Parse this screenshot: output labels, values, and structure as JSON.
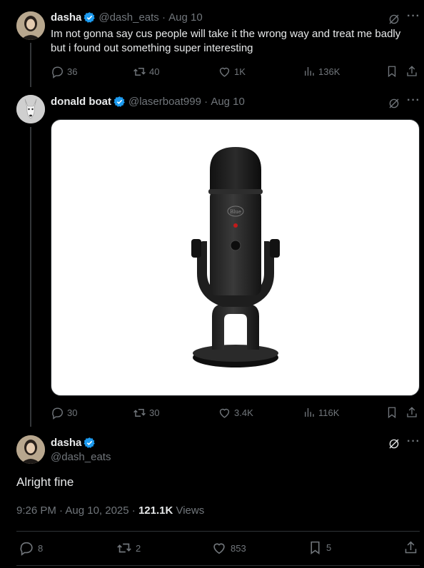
{
  "tweet1": {
    "name": "dasha",
    "handle": "@dash_eats",
    "date": "Aug 10",
    "text": "Im not gonna say cus people will take it the wrong way and treat me badly but i found out something super interesting",
    "replies": "36",
    "reposts": "40",
    "likes": "1K",
    "views": "136K"
  },
  "tweet2": {
    "name": "donald boat",
    "handle": "@laserboat999",
    "date": "Aug 10",
    "media_alt": "Blue Yeti microphone",
    "mic_brand": "Blue",
    "replies": "30",
    "reposts": "30",
    "likes": "3.4K",
    "views": "116K"
  },
  "tweet3": {
    "name": "dasha",
    "handle": "@dash_eats",
    "text": "Alright fine",
    "timestamp": "9:26 PM · Aug 10, 2025 · ",
    "views_count": "121.1K",
    "views_label": " Views",
    "replies": "8",
    "reposts": "2",
    "likes": "853",
    "bookmarks": "5"
  },
  "colors": {
    "background": "#000000",
    "text": "#e7e9ea",
    "secondary": "#71767b",
    "verified": "#1d9bf0",
    "divider": "#2f3336"
  },
  "icons": [
    "grok-icon",
    "more-icon",
    "reply-icon",
    "repost-icon",
    "like-icon",
    "views-icon",
    "bookmark-icon",
    "share-icon",
    "verified-badge-icon"
  ]
}
